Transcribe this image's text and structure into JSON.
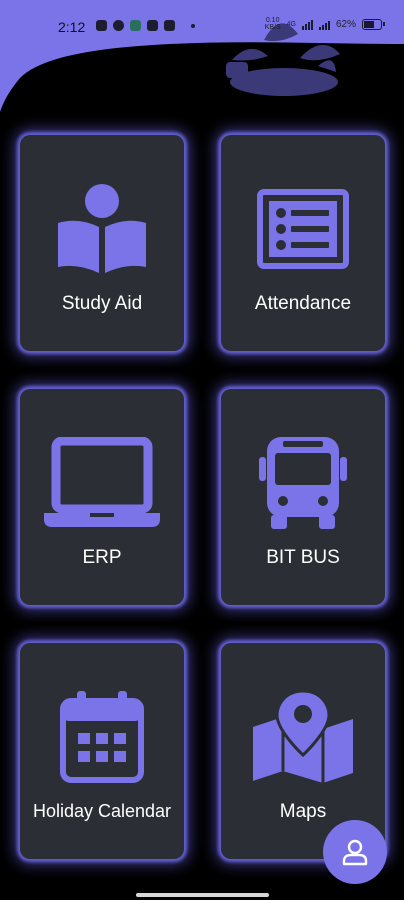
{
  "status_bar": {
    "time": "2:12",
    "net_speed_value": "0.10",
    "net_speed_unit": "KB/S",
    "network_type": "4G",
    "battery": "62%",
    "battery_level": 0.62
  },
  "colors": {
    "accent": "#7b74e8",
    "tile_bg": "#2b2e35",
    "glow": "#6e69e6",
    "background": "#000000"
  },
  "tiles": [
    {
      "label": "Study Aid",
      "icon": "reading-book-icon"
    },
    {
      "label": "Attendance",
      "icon": "list-icon"
    },
    {
      "label": "ERP",
      "icon": "laptop-icon"
    },
    {
      "label": "BIT BUS",
      "icon": "bus-icon"
    },
    {
      "label": "Holiday Calendar",
      "icon": "calendar-icon"
    },
    {
      "label": "Maps",
      "icon": "map-pin-icon"
    }
  ],
  "fab": {
    "icon": "profile-icon"
  }
}
